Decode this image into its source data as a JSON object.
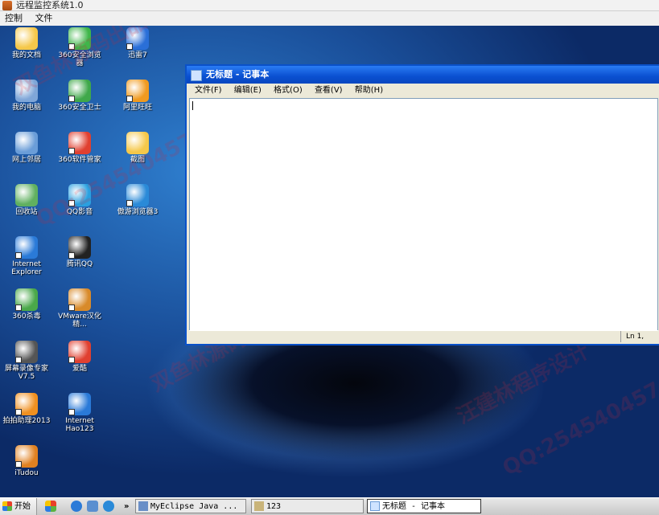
{
  "app": {
    "title": "远程监控系统1.0",
    "menu": [
      "控制",
      "文件"
    ]
  },
  "desktop_icons": [
    {
      "label": "我的文档",
      "icon": "folder-documents-icon",
      "color": "#f5c84a"
    },
    {
      "label": "360安全浏览器",
      "icon": "browser-360-icon",
      "color": "#3fb64a"
    },
    {
      "label": "迅雷7",
      "icon": "thunder-icon",
      "color": "#2a6fd8"
    },
    {
      "label": "我的电脑",
      "icon": "computer-icon",
      "color": "#7fa6d8"
    },
    {
      "label": "360安全卫士",
      "icon": "shield-360-icon",
      "color": "#3fa84a"
    },
    {
      "label": "阿里旺旺",
      "icon": "wangwang-icon",
      "color": "#f09a20"
    },
    {
      "label": "网上邻居",
      "icon": "network-icon",
      "color": "#6a9dd8"
    },
    {
      "label": "360软件管家",
      "icon": "software-manager-icon",
      "color": "#e04030"
    },
    {
      "label": "截图",
      "icon": "folder-icon",
      "color": "#f5c84a"
    },
    {
      "label": "回收站",
      "icon": "recycle-bin-icon",
      "color": "#60b060"
    },
    {
      "label": "QQ影音",
      "icon": "qq-video-icon",
      "color": "#2aa0e0"
    },
    {
      "label": "傲游浏览器3",
      "icon": "maxthon-icon",
      "color": "#2a8ad8"
    },
    {
      "label": "Internet Explorer",
      "icon": "ie-icon",
      "color": "#2a7ad8"
    },
    {
      "label": "腾讯QQ",
      "icon": "qq-penguin-icon",
      "color": "#222222"
    },
    {
      "label": "360杀毒",
      "icon": "antivirus-360-icon",
      "color": "#4aa84a"
    },
    {
      "label": "VMware汉化精...",
      "icon": "vmware-icon",
      "color": "#d88a2a"
    },
    {
      "label": "屏幕录像专家V7.5",
      "icon": "screen-recorder-icon",
      "color": "#555555"
    },
    {
      "label": "爱酷",
      "icon": "player-icon",
      "color": "#e04030"
    },
    {
      "label": "拍拍助理2013",
      "icon": "paipai-icon",
      "color": "#f09020"
    },
    {
      "label": "Internet Hao123",
      "icon": "ie-hao123-icon",
      "color": "#2a7ad8"
    },
    {
      "label": "iTudou",
      "icon": "itudou-icon",
      "color": "#e08020"
    }
  ],
  "notepad": {
    "title": "无标题 - 记事本",
    "menu": [
      "文件(F)",
      "编辑(E)",
      "格式(O)",
      "查看(V)",
      "帮助(H)"
    ],
    "status": "Ln 1,"
  },
  "taskbar": {
    "start_label": "开始",
    "chevron": "»",
    "tasks": [
      "MyEclipse Java ...",
      "123",
      "无标题 - 记事本"
    ]
  },
  "watermarks": [
    "双鱼林源码出品",
    "QQ:254540457",
    "汪建林程序设计"
  ]
}
